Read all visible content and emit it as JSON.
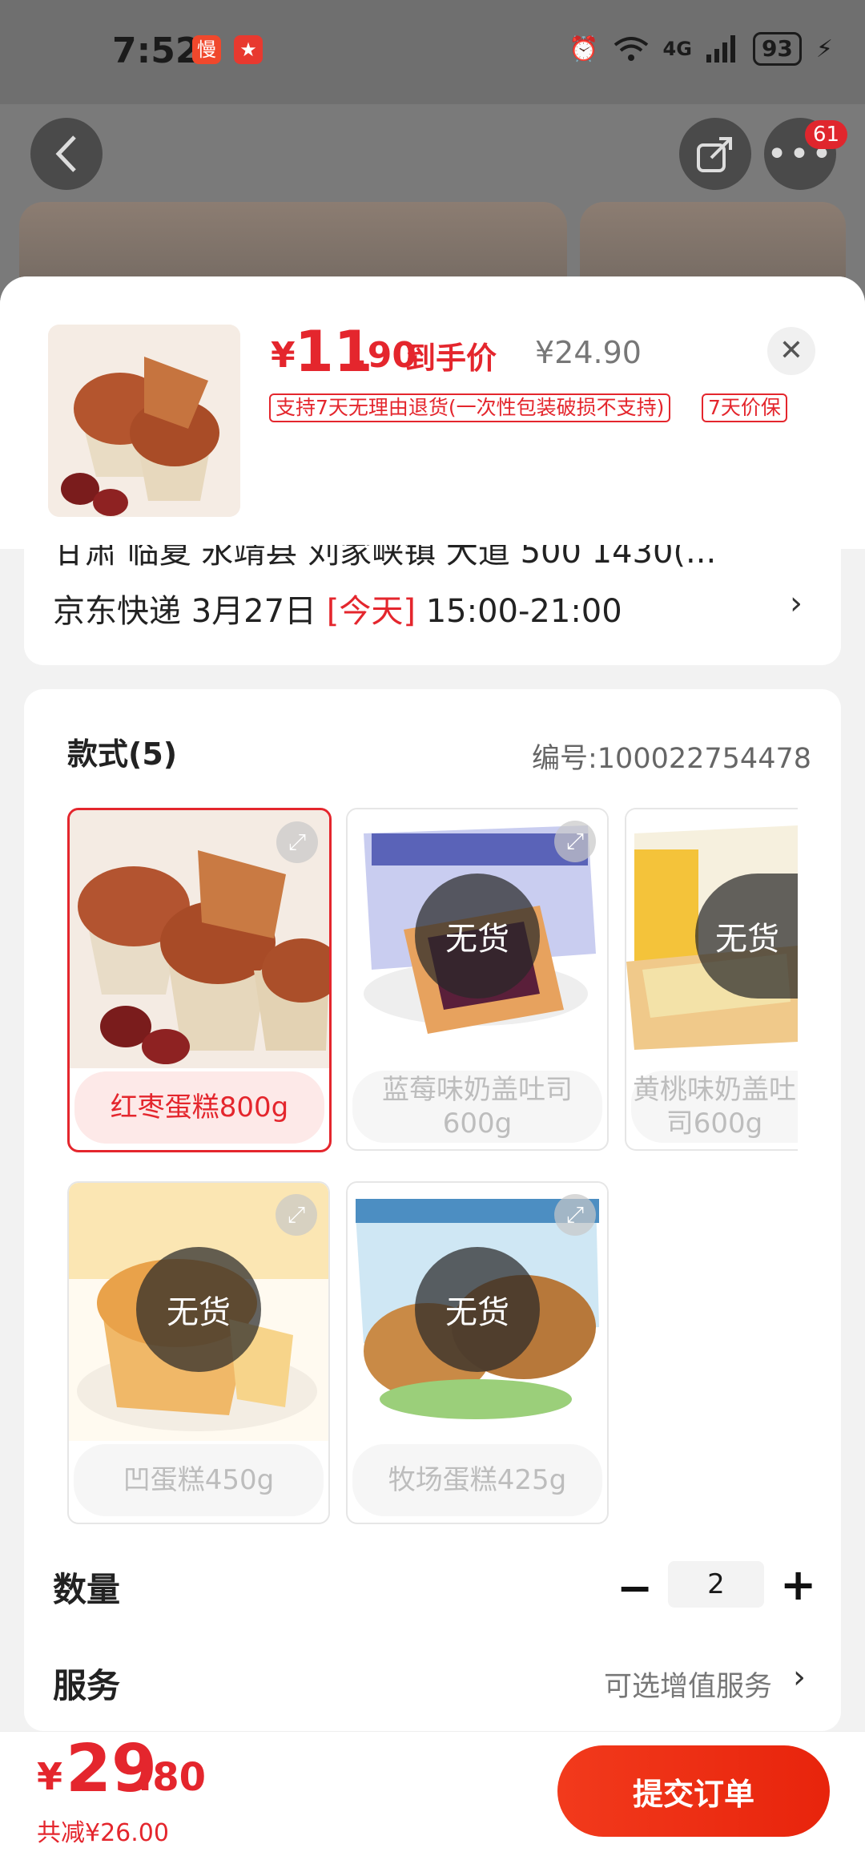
{
  "status_bar": {
    "time": "7:52",
    "badge1": "慢",
    "badge2": "★",
    "network": "4G",
    "battery": "93"
  },
  "nav": {
    "back_icon": "chevron-left",
    "share_icon": "share",
    "more_icon": "ellipsis",
    "notification_count": "61"
  },
  "product": {
    "price_symbol": "¥",
    "price_int": "11",
    "price_dec": ".90",
    "price_label": "到手价",
    "original_price": "¥24.90",
    "tags": [
      "支持7天无理由退货(一次性包装破损不支持)",
      "7天价保"
    ]
  },
  "delivery": {
    "address_cut": "甘肃 临夏 永靖县 刘家峡镇 大道 500 1430(...",
    "carrier": "京东快递 3月27日",
    "today": "[今天]",
    "time_window": "15:00-21:00"
  },
  "options": {
    "section_title": "款式(5)",
    "sku": "编号:100022754478",
    "out_of_stock": "无货",
    "variants": [
      {
        "label": "红枣蛋糕800g",
        "selected": true,
        "available": true
      },
      {
        "label": "蓝莓味奶盖吐司600g",
        "selected": false,
        "available": false
      },
      {
        "label": "黄桃味奶盖吐司600g",
        "selected": false,
        "available": false
      },
      {
        "label": "凹蛋糕450g",
        "selected": false,
        "available": false
      },
      {
        "label": "牧场蛋糕425g",
        "selected": false,
        "available": false
      }
    ]
  },
  "quantity": {
    "label": "数量",
    "minus": "−",
    "value": "2",
    "plus": "+"
  },
  "service": {
    "label": "服务",
    "value": "可选增值服务"
  },
  "footer": {
    "total_symbol": "¥",
    "total_int": "29",
    "total_dec": ".80",
    "savings": "共减¥26.00",
    "submit_label": "提交订单"
  },
  "colors": {
    "accent": "#e4262d",
    "button": "#f23a1c"
  }
}
